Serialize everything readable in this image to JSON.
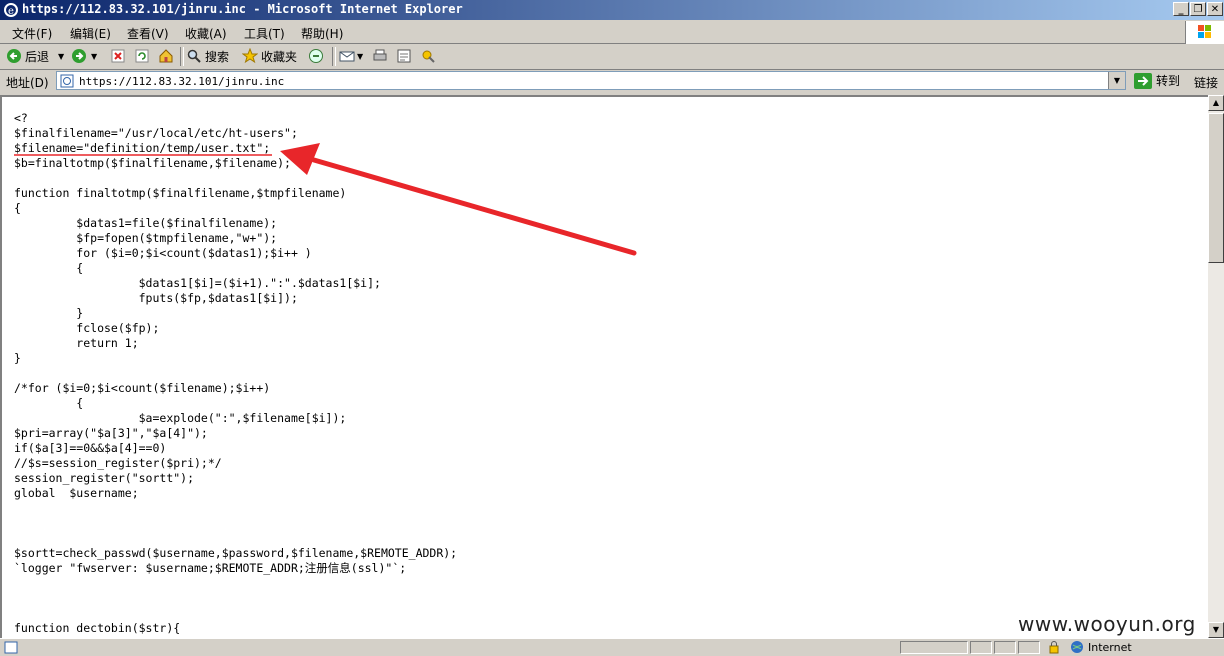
{
  "window": {
    "title": "https://112.83.32.101/jinru.inc - Microsoft Internet Explorer"
  },
  "menu": [
    {
      "label": "文件(F)"
    },
    {
      "label": "编辑(E)"
    },
    {
      "label": "查看(V)"
    },
    {
      "label": "收藏(A)"
    },
    {
      "label": "工具(T)"
    },
    {
      "label": "帮助(H)"
    }
  ],
  "toolbar": {
    "back_label": "后退",
    "search_label": "搜索",
    "favorites_label": "收藏夹"
  },
  "address": {
    "label": "地址(D)",
    "value": "https://112.83.32.101/jinru.inc",
    "go_label": "转到",
    "links_label": "链接"
  },
  "code_lines": [
    "<?",
    "$finalfilename=\"/usr/local/etc/ht-users\";",
    "$filename=\"definition/temp/user.txt\";",
    "$b=finaltotmp($finalfilename,$filename);",
    "",
    "function finaltotmp($finalfilename,$tmpfilename)",
    "{",
    "         $datas1=file($finalfilename);",
    "         $fp=fopen($tmpfilename,\"w+\");",
    "         for ($i=0;$i<count($datas1);$i++ )",
    "         {",
    "                  $datas1[$i]=($i+1).\":\".$datas1[$i];",
    "                  fputs($fp,$datas1[$i]);",
    "         }",
    "         fclose($fp);",
    "         return 1;",
    "}",
    "",
    "/*for ($i=0;$i<count($filename);$i++)",
    "         {",
    "                  $a=explode(\":\",$filename[$i]);",
    "$pri=array(\"$a[3]\",\"$a[4]\");",
    "if($a[3]==0&&$a[4]==0)",
    "//$s=session_register($pri);*/",
    "session_register(\"sortt\");",
    "global  $username;",
    "",
    "",
    "",
    "$sortt=check_passwd($username,$password,$filename,$REMOTE_ADDR);",
    "`logger \"fwserver: $username;$REMOTE_ADDR;注册信息(ssl)\"`;",
    "",
    "",
    "",
    "function dectobin($str){"
  ],
  "status": {
    "zone_label": "Internet"
  },
  "watermark": "www.wooyun.org",
  "colors": {
    "annotation_red": "#e8262a",
    "titlebar_start": "#0a246a",
    "titlebar_end": "#a6caf0"
  }
}
